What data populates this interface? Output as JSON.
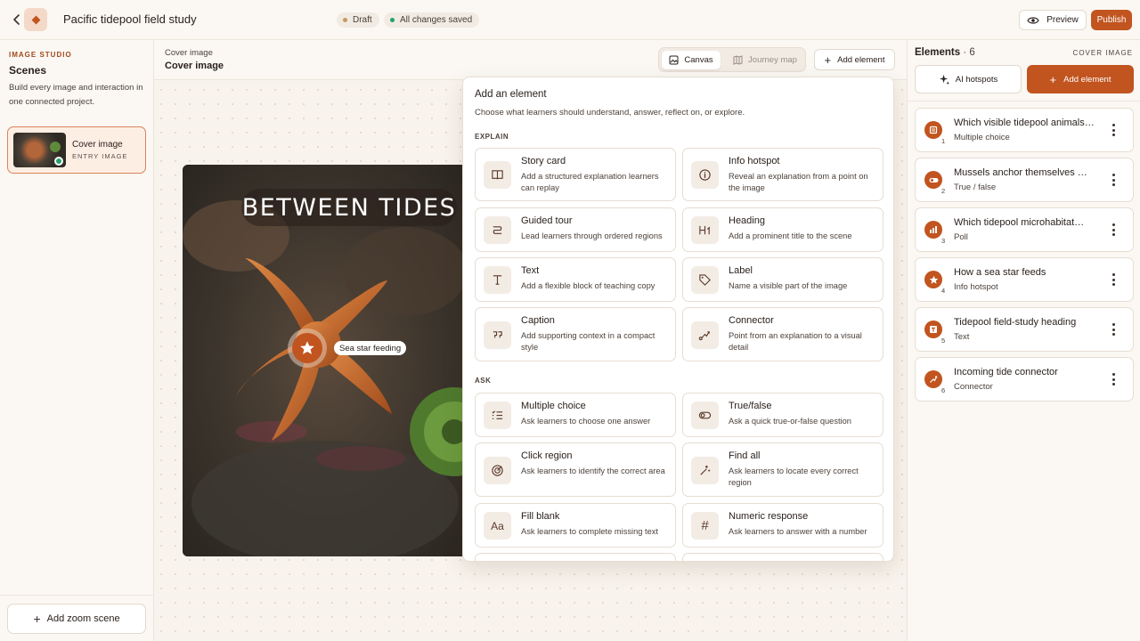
{
  "header": {
    "project_title": "Pacific tidepool field study",
    "status_draft": "Draft",
    "status_saved": "All changes saved",
    "preview_label": "Preview",
    "publish_label": "Publish"
  },
  "sidebar": {
    "studio_label": "IMAGE STUDIO",
    "title": "Scenes",
    "description": "Build every image and interaction in one connected project.",
    "scenes": [
      {
        "name": "Cover image",
        "subtitle": "ENTRY IMAGE"
      }
    ],
    "add_zoom_label": "Add zoom scene"
  },
  "canvas": {
    "breadcrumb_small": "Cover image",
    "breadcrumb_title": "Cover image",
    "view_canvas_label": "Canvas",
    "view_journey_label": "Journey map",
    "add_element_label": "Add element",
    "image_title": "BETWEEN TIDES",
    "hotspot_label": "Sea star feeding"
  },
  "popover": {
    "title": "Add an element",
    "subtitle": "Choose what learners should understand, answer, reflect on, or explore.",
    "section_explain": "EXPLAIN",
    "section_ask": "ASK",
    "explain": [
      {
        "title": "Story card",
        "desc": "Add a structured explanation learners can replay",
        "icon": "book-icon"
      },
      {
        "title": "Info hotspot",
        "desc": "Reveal an explanation from a point on the image",
        "icon": "info-icon"
      },
      {
        "title": "Guided tour",
        "desc": "Lead learners through ordered regions",
        "icon": "route-icon"
      },
      {
        "title": "Heading",
        "desc": "Add a prominent title to the scene",
        "icon": "heading-icon"
      },
      {
        "title": "Text",
        "desc": "Add a flexible block of teaching copy",
        "icon": "text-icon"
      },
      {
        "title": "Label",
        "desc": "Name a visible part of the image",
        "icon": "tag-icon"
      },
      {
        "title": "Caption",
        "desc": "Add supporting context in a compact style",
        "icon": "quote-icon"
      },
      {
        "title": "Connector",
        "desc": "Point from an explanation to a visual detail",
        "icon": "connector-icon"
      }
    ],
    "ask": [
      {
        "title": "Multiple choice",
        "desc": "Ask learners to choose one answer",
        "icon": "list-check-icon"
      },
      {
        "title": "True/false",
        "desc": "Ask a quick true-or-false question",
        "icon": "toggle-icon"
      },
      {
        "title": "Click region",
        "desc": "Ask learners to identify the correct area",
        "icon": "target-icon"
      },
      {
        "title": "Find all",
        "desc": "Ask learners to locate every correct region",
        "icon": "sparkle-wand-icon"
      },
      {
        "title": "Fill blank",
        "desc": "Ask learners to complete missing text",
        "icon": "font-aa-icon"
      },
      {
        "title": "Numeric response",
        "desc": "Ask learners to answer with a number",
        "icon": "hash-icon"
      }
    ]
  },
  "elements_panel": {
    "title": "Elements",
    "count": "· 6",
    "context": "COVER IMAGE",
    "ai_label": "AI hotspots",
    "add_label": "Add element",
    "items": [
      {
        "number": "1",
        "title": "Which visible tidepool animals…",
        "type": "Multiple choice",
        "icon": "list-icon"
      },
      {
        "number": "2",
        "title": "Mussels anchor themselves …",
        "type": "True / false",
        "icon": "toggle-icon"
      },
      {
        "number": "3",
        "title": "Which tidepool microhabitat…",
        "type": "Poll",
        "icon": "bar-chart-icon"
      },
      {
        "number": "4",
        "title": "How a sea star feeds",
        "type": "Info hotspot",
        "icon": "star-icon"
      },
      {
        "number": "5",
        "title": "Tidepool field-study heading",
        "type": "Text",
        "icon": "text-icon"
      },
      {
        "number": "6",
        "title": "Incoming tide connector",
        "type": "Connector",
        "icon": "connector-icon"
      }
    ]
  },
  "colors": {
    "accent": "#c1541f",
    "saved_dot": "#22a06b",
    "draft_dot": "#c69a59"
  }
}
